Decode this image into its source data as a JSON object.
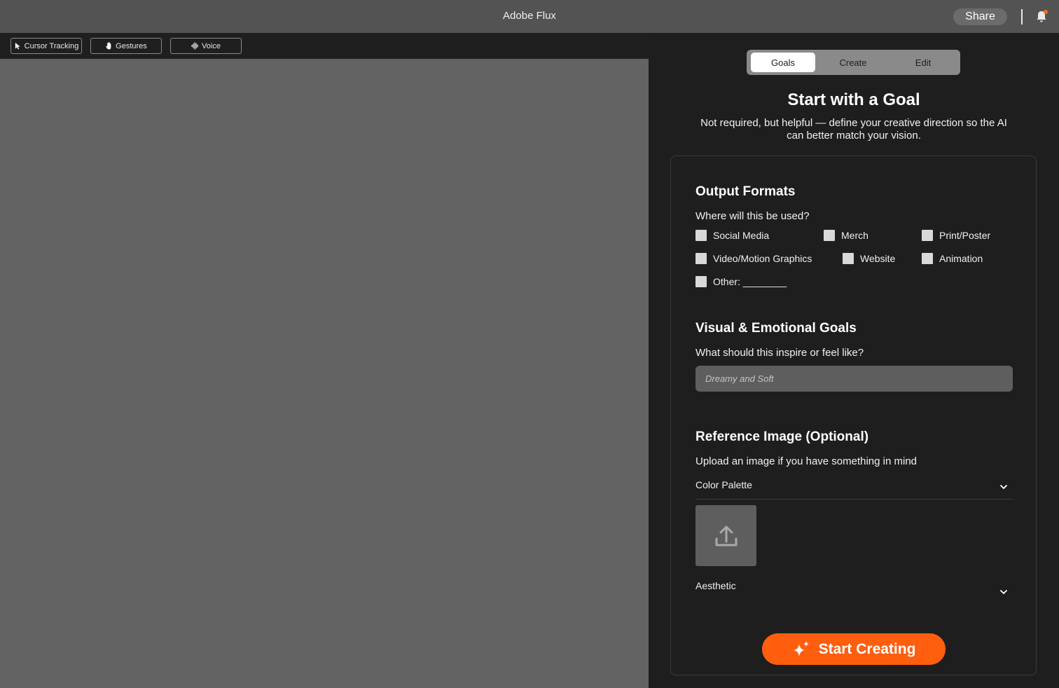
{
  "app": {
    "title": "Adobe Flux"
  },
  "header": {
    "share_label": "Share"
  },
  "toolbar": {
    "cursor_tracking": "Cursor Tracking",
    "gestures": "Gestures",
    "voice": "Voice"
  },
  "tabs": [
    {
      "label": "Goals",
      "active": true
    },
    {
      "label": "Create",
      "active": false
    },
    {
      "label": "Edit",
      "active": false
    }
  ],
  "panel": {
    "heading": "Start with a Goal",
    "subtitle": "Not required, but helpful — define your creative direction so the AI can better match your vision."
  },
  "output_formats": {
    "title": "Output Formats",
    "question": "Where will this be used?",
    "options": [
      {
        "label": "Social Media",
        "checked": false
      },
      {
        "label": "Merch",
        "checked": false
      },
      {
        "label": "Print/Poster",
        "checked": false
      },
      {
        "label": "Video/Motion Graphics",
        "checked": false
      },
      {
        "label": "Website",
        "checked": false
      },
      {
        "label": "Animation",
        "checked": false
      },
      {
        "label": "Other: ________",
        "checked": false
      }
    ]
  },
  "visual_goals": {
    "title": "Visual & Emotional Goals",
    "question": "What should this inspire or feel like?",
    "placeholder": "Dreamy and Soft",
    "value": ""
  },
  "reference": {
    "title": "Reference Image (Optional)",
    "subtitle": "Upload an image if you have something in mind",
    "color_palette_label": "Color Palette",
    "aesthetic_label": "Aesthetic"
  },
  "cta": {
    "label": "Start Creating"
  },
  "colors": {
    "accent": "#ff5e0e",
    "titlebar": "#535353",
    "canvas": "#636363",
    "panel": "#1e1e1e"
  },
  "icons": {
    "bell": "bell-icon",
    "cursor": "cursor-icon",
    "hand": "hand-icon",
    "voice": "waveform-icon",
    "upload": "upload-icon",
    "sparkle": "sparkle-icon",
    "chevron": "chevron-down-icon"
  }
}
